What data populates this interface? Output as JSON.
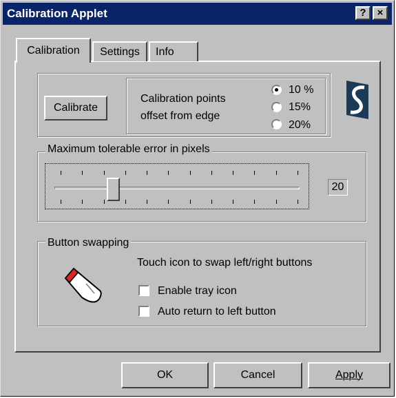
{
  "window": {
    "title": "Calibration Applet",
    "help_label": "?",
    "close_label": "×"
  },
  "tabs": [
    {
      "label": "Calibration",
      "active": true
    },
    {
      "label": "Settings",
      "active": false
    },
    {
      "label": "Info",
      "active": false
    }
  ],
  "calibration": {
    "button_label": "Calibrate",
    "offset_line1": "Calibration points",
    "offset_line2": "offset from edge",
    "options": [
      {
        "label": "10 %",
        "selected": true
      },
      {
        "label": "15%",
        "selected": false
      },
      {
        "label": "20%",
        "selected": false
      }
    ],
    "logo_icon": "s-logo-icon"
  },
  "error_group": {
    "label": "Maximum tolerable error in pixels",
    "value_display": "20",
    "slider_fraction": 0.22
  },
  "swap_group": {
    "label": "Button swapping",
    "instruction": "Touch icon to swap left/right buttons",
    "icon": "pen-mouse-icon",
    "enable_tray_label": "Enable tray icon",
    "enable_tray_checked": false,
    "auto_return_label": "Auto return to left button",
    "auto_return_checked": false
  },
  "footer": {
    "ok_label": "OK",
    "cancel_label": "Cancel",
    "apply_label": "Apply"
  },
  "colors": {
    "titlebar": "#0a246a",
    "face": "#c0c0c0",
    "logo": "#1b3a57"
  }
}
